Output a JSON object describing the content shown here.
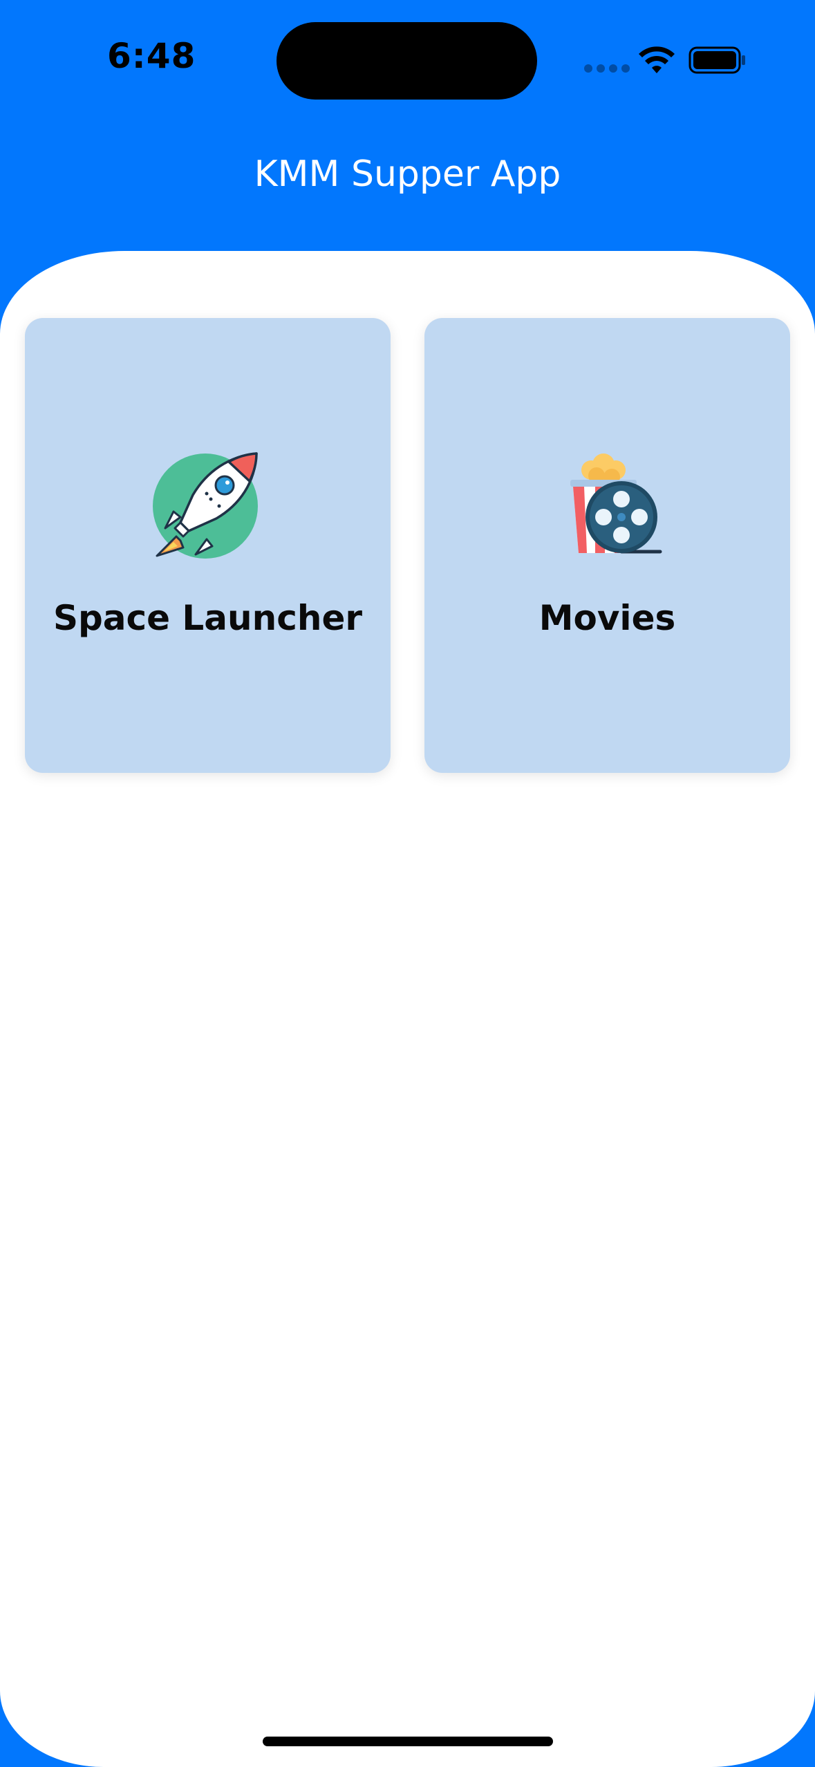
{
  "status_bar": {
    "time": "6:48",
    "icons": [
      "cellular-signal-icon",
      "wifi-icon",
      "battery-icon"
    ]
  },
  "header": {
    "title": "KMM Supper App"
  },
  "colors": {
    "primary": "#0277FD",
    "card_background": "#C0D8F2",
    "sheet_background": "#FFFFFF"
  },
  "features": [
    {
      "label": "Space Launcher",
      "icon": "rocket-icon"
    },
    {
      "label": "Movies",
      "icon": "popcorn-film-reel-icon"
    }
  ]
}
